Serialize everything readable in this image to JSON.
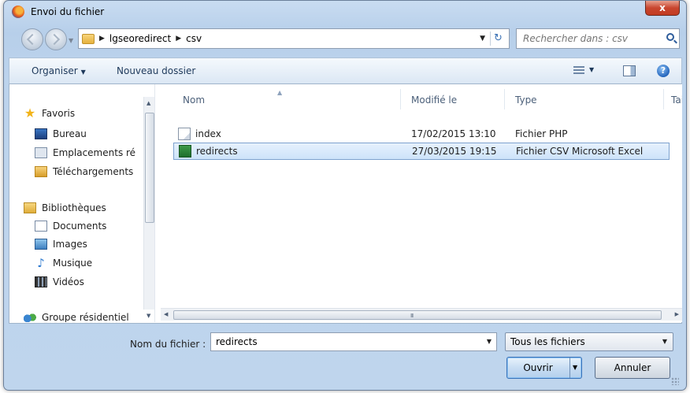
{
  "window": {
    "title": "Envoi du fichier",
    "close_label": "x"
  },
  "address": {
    "crumbs": [
      "lgseoredirect",
      "csv"
    ]
  },
  "search": {
    "placeholder": "Rechercher dans : csv"
  },
  "toolbar": {
    "organize_label": "Organiser",
    "new_folder_label": "Nouveau dossier"
  },
  "nav": {
    "items": [
      {
        "label": "Favoris",
        "icon": "star-icon"
      },
      {
        "label": "Bureau",
        "icon": "desktop-icon"
      },
      {
        "label": "Emplacements ré",
        "icon": "recent-places-icon"
      },
      {
        "label": "Téléchargements",
        "icon": "downloads-icon"
      },
      {
        "label": "Bibliothèques",
        "icon": "libraries-icon"
      },
      {
        "label": "Documents",
        "icon": "documents-icon"
      },
      {
        "label": "Images",
        "icon": "pictures-icon"
      },
      {
        "label": "Musique",
        "icon": "music-icon"
      },
      {
        "label": "Vidéos",
        "icon": "videos-icon"
      },
      {
        "label": "Groupe résidentiel",
        "icon": "homegroup-icon"
      }
    ]
  },
  "columns": {
    "name": "Nom",
    "modified": "Modifié le",
    "type": "Type",
    "size": "Taill"
  },
  "files": [
    {
      "name": "index",
      "modified": "17/02/2015 13:10",
      "type": "Fichier PHP",
      "icon": "php-file-icon",
      "selected": false
    },
    {
      "name": "redirects",
      "modified": "27/03/2015 19:15",
      "type": "Fichier CSV Microsoft Excel",
      "icon": "csv-file-icon",
      "selected": true
    }
  ],
  "hscroll_grip": "III",
  "footer": {
    "filename_label": "Nom du fichier :",
    "filename_value": "redirects",
    "filetype_value": "Tous les fichiers",
    "open_label": "Ouvrir",
    "cancel_label": "Annuler"
  },
  "colors": {
    "selection": "#cde3fa",
    "selection_border": "#7da2ce",
    "accent": "#3b73b9"
  }
}
